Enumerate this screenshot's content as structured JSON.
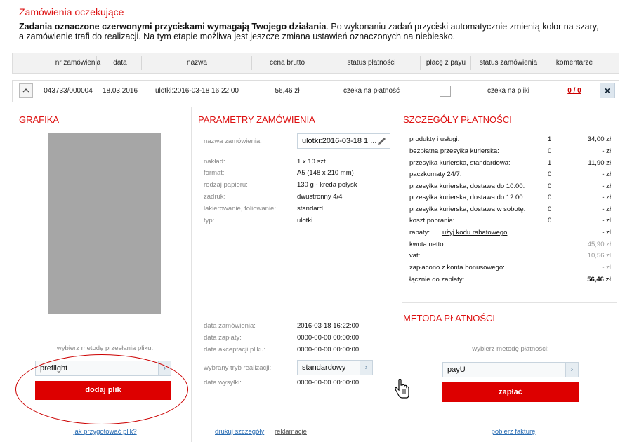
{
  "page": {
    "title": "Zamówienia oczekujące",
    "intro_bold": "Zadania oznaczone czerwonymi przyciskami wymagają Twojego działania",
    "intro_rest": ". Po wykonaniu zadań przyciski automatycznie zmienią kolor na szary, a zamówienie trafi do realizacji. Na tym etapie możliwa jest jeszcze zmiana ustawień oznaczonych na niebiesko."
  },
  "table": {
    "headers": [
      "nr zamówienia",
      "data",
      "nazwa",
      "cena brutto",
      "status płatności",
      "płacę z payu",
      "status zamówienia",
      "komentarze"
    ],
    "row": {
      "order_no": "043733/000004",
      "date": "18.03.2016",
      "name": "ulotki:2016-03-18 16:22:00",
      "price": "56,46 zł",
      "payment_status": "czeka na płatność",
      "order_status": "czeka na pliki",
      "comments": "0 / 0",
      "close": "×",
      "collapse": "^"
    }
  },
  "grafika": {
    "title": "GRAFIKA",
    "upload_label": "wybierz metodę przesłania pliku:",
    "upload_method": "preflight",
    "add_button": "dodaj plik",
    "help_link": "jak przygotować plik?"
  },
  "parametry": {
    "title": "PARAMETRY ZAMÓWIENIA",
    "name_label": "nazwa zamówienia:",
    "name_value": "ulotki:2016-03-18 1 ...",
    "params": [
      {
        "label": "nakład:",
        "value": "1 x 10 szt."
      },
      {
        "label": "format:",
        "value": "A5 (148 x 210 mm)"
      },
      {
        "label": "rodzaj papieru:",
        "value": "130 g - kreda połysk"
      },
      {
        "label": "zadruk:",
        "value": "dwustronny 4/4"
      },
      {
        "label": "lakierowanie, foliowanie:",
        "value": "standard"
      },
      {
        "label": "typ:",
        "value": "ulotki"
      }
    ],
    "dates": [
      {
        "label": "data zamówienia:",
        "value": "2016-03-18 16:22:00"
      },
      {
        "label": "data zapłaty:",
        "value": "0000-00-00 00:00:00"
      },
      {
        "label": "data akceptacji pliku:",
        "value": "0000-00-00 00:00:00"
      }
    ],
    "mode_label": "wybrany tryb realizacji:",
    "mode_value": "standardowy",
    "ship_label": "data wysyłki:",
    "ship_value": "0000-00-00 00:00:00",
    "print_link": "drukuj szczegóły",
    "complaint_link": "reklamacje"
  },
  "platnosc": {
    "title": "SZCZEGÓŁY PŁATNOŚCI",
    "rows": [
      {
        "label": "produkty i usługi:",
        "qty": "1",
        "amount": "34,00 zł"
      },
      {
        "label": "bezpłatna przesyłka kurierska:",
        "qty": "0",
        "amount": "- zł"
      },
      {
        "label": "przesyłka kurierska, standardowa:",
        "qty": "1",
        "amount": "11,90 zł"
      },
      {
        "label": "paczkomaty 24/7:",
        "qty": "0",
        "amount": "- zł"
      },
      {
        "label": "przesyłka kurierska, dostawa do 10:00:",
        "qty": "0",
        "amount": "- zł"
      },
      {
        "label": "przesyłka kurierska, dostawa do 12:00:",
        "qty": "0",
        "amount": "- zł"
      },
      {
        "label": "przesyłka kurierska, dostawa w sobotę:",
        "qty": "0",
        "amount": "- zł"
      },
      {
        "label": "koszt pobrania:",
        "qty": "0",
        "amount": "- zł"
      }
    ],
    "rabaty_label": "rabaty:",
    "rabaty_link": "użyj kodu rabatowego",
    "rabaty_amount": "- zł",
    "netto_label": "kwota netto:",
    "netto_amount": "45,90 zł",
    "vat_label": "vat:",
    "vat_amount": "10,56 zł",
    "bonus_label": "zapłacono z konta bonusowego:",
    "bonus_amount": "- zł",
    "total_label": "łącznie do zapłaty:",
    "total_amount": "56,46 zł",
    "method_title": "METODA PŁATNOŚCI",
    "method_label": "wybierz metodę płatności:",
    "method_value": "payU",
    "pay_button": "zapłać",
    "invoice_link": "pobierz fakturę"
  },
  "colors": {
    "accent": "#dd0000",
    "title_red": "#dd1111",
    "link": "#2a6db3"
  },
  "icons": [
    "chevron-up-icon",
    "close-icon",
    "pencil-icon",
    "chevron-right-icon",
    "hand-cursor-icon"
  ]
}
